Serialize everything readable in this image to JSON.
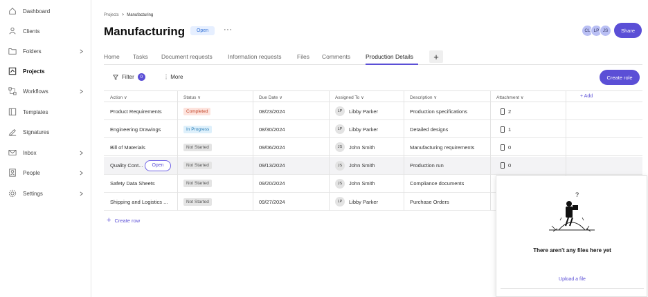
{
  "sidebar": {
    "items": [
      {
        "label": "Dashboard",
        "icon": "home-icon",
        "chevron": false
      },
      {
        "label": "Clients",
        "icon": "users-icon",
        "chevron": false
      },
      {
        "label": "Folders",
        "icon": "folder-icon",
        "chevron": true
      },
      {
        "label": "Projects",
        "icon": "projects-icon",
        "chevron": false,
        "active": true
      },
      {
        "label": "Workflows",
        "icon": "workflows-icon",
        "chevron": true
      },
      {
        "label": "Templates",
        "icon": "templates-icon",
        "chevron": false
      },
      {
        "label": "Signatures",
        "icon": "signature-icon",
        "chevron": false
      },
      {
        "label": "Inbox",
        "icon": "mail-icon",
        "chevron": true
      },
      {
        "label": "People",
        "icon": "people-icon",
        "chevron": true
      },
      {
        "label": "Settings",
        "icon": "gear-icon",
        "chevron": true
      }
    ]
  },
  "breadcrumb": {
    "parent": "Projects",
    "separator": ">",
    "current": "Manufacturing"
  },
  "header": {
    "title": "Manufacturing",
    "status": "Open",
    "more": "···",
    "avatars": [
      "CL",
      "LP",
      "JS"
    ],
    "share_label": "Share"
  },
  "tabs": [
    {
      "label": "Home"
    },
    {
      "label": "Tasks"
    },
    {
      "label": "Document requests"
    },
    {
      "label": "Information requests"
    },
    {
      "label": "Files"
    },
    {
      "label": "Comments"
    },
    {
      "label": "Production Details",
      "active": true
    }
  ],
  "tab_add": "+",
  "toolbar": {
    "filter_label": "Filter",
    "filter_count": "0",
    "more_label": "⋮ More",
    "create_role_label": "Create role"
  },
  "table": {
    "columns": [
      "Action",
      "Status",
      "Due Date",
      "Assigned To",
      "Description",
      "Attachment"
    ],
    "add_label": "+ Add",
    "rows": [
      {
        "action": "Product Requirements",
        "status": "Completed",
        "status_kind": "completed",
        "due": "08/23/2024",
        "initials": "LP",
        "assignee": "Libby Parker",
        "description": "Production specifications",
        "attachments": "2"
      },
      {
        "action": "Engineering Drawings",
        "status": "In Progress",
        "status_kind": "progress",
        "due": "08/30/2024",
        "initials": "LP",
        "assignee": "Libby Parker",
        "description": "Detailed designs",
        "attachments": "1"
      },
      {
        "action": "Bill of Materials",
        "status": "Not Started",
        "status_kind": "notstarted",
        "due": "09/06/2024",
        "initials": "JS",
        "assignee": "John Smith",
        "description": "Manufacturing requirements",
        "attachments": "0"
      },
      {
        "action": "Quality Cont...",
        "status": "Not Started",
        "status_kind": "notstarted",
        "due": "09/13/2024",
        "initials": "JS",
        "assignee": "John Smith",
        "description": "Production run",
        "attachments": "0",
        "highlight": true
      },
      {
        "action": "Safety Data Sheets",
        "status": "Not Started",
        "status_kind": "notstarted",
        "due": "09/20/2024",
        "initials": "JS",
        "assignee": "John Smith",
        "description": "Compliance documents",
        "attachments": ""
      },
      {
        "action": "Shipping and Logistics ...",
        "status": "Not Started",
        "status_kind": "notstarted",
        "due": "09/27/2024",
        "initials": "LP",
        "assignee": "Libby Parker",
        "description": "Purchase Orders",
        "attachments": ""
      }
    ],
    "open_pill": "Open",
    "create_row_label": "Create row"
  },
  "files_panel": {
    "empty_text": "There aren't any files here yet",
    "upload_label": "Upload a file"
  },
  "colors": {
    "accent": "#5b4fd6"
  }
}
